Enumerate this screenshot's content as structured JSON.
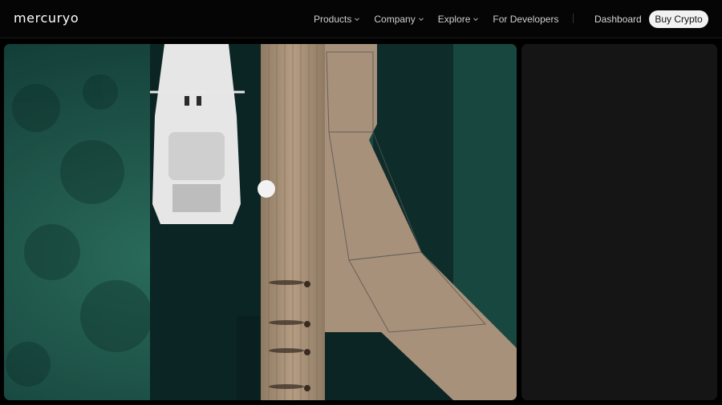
{
  "header": {
    "logo_text": "mercuryo",
    "nav": [
      {
        "label": "Products",
        "has_dropdown": true
      },
      {
        "label": "Company",
        "has_dropdown": true
      },
      {
        "label": "Explore",
        "has_dropdown": true
      },
      {
        "label": "For Developers",
        "has_dropdown": false
      }
    ],
    "dashboard_label": "Dashboard",
    "buy_label": "Buy Crypto"
  },
  "hero": {
    "image_subject": "aerial view of sailboat docked beside wooden pier over green water",
    "slider_handle_icon": "circle-handle-icon"
  },
  "colors": {
    "background": "#000000",
    "header": "#050505",
    "button_bg": "#f2f2f2",
    "panel": "#151515",
    "water_dark": "#0d2e2c",
    "water_green": "#1f5a4d",
    "deck": "#a58e74"
  }
}
